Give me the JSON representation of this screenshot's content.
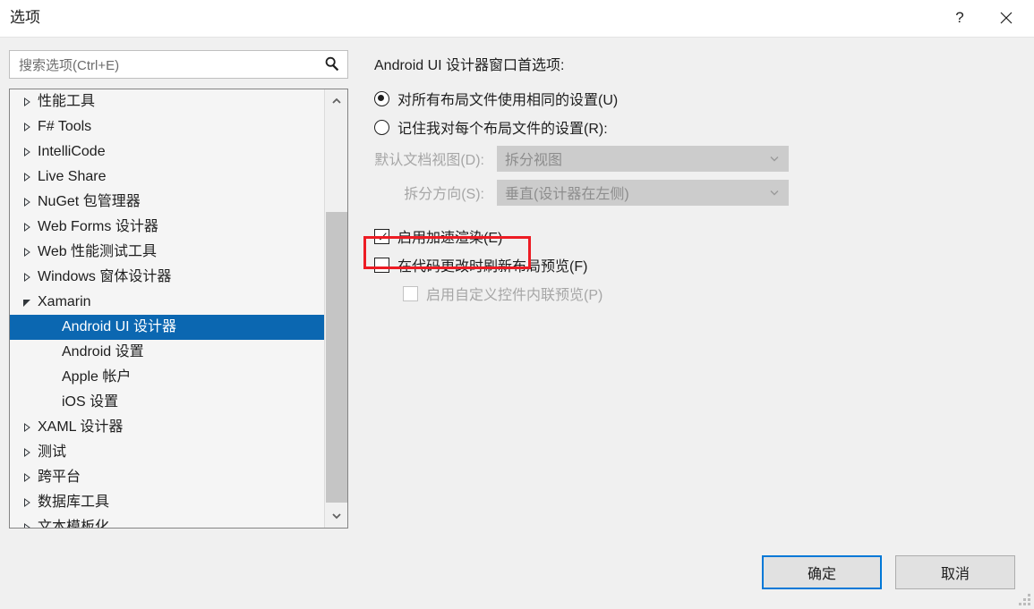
{
  "window": {
    "title": "选项",
    "help_icon": "question-mark-icon",
    "close_icon": "close-icon"
  },
  "search": {
    "placeholder": "搜索选项(Ctrl+E)",
    "value": "",
    "icon": "search-icon"
  },
  "tree": {
    "items": [
      {
        "label": "性能工具",
        "expander": "collapsed",
        "level": 1,
        "selected": false
      },
      {
        "label": "F# Tools",
        "expander": "collapsed",
        "level": 1,
        "selected": false
      },
      {
        "label": "IntelliCode",
        "expander": "collapsed",
        "level": 1,
        "selected": false
      },
      {
        "label": "Live Share",
        "expander": "collapsed",
        "level": 1,
        "selected": false
      },
      {
        "label": "NuGet 包管理器",
        "expander": "collapsed",
        "level": 1,
        "selected": false
      },
      {
        "label": "Web Forms 设计器",
        "expander": "collapsed",
        "level": 1,
        "selected": false
      },
      {
        "label": "Web 性能测试工具",
        "expander": "collapsed",
        "level": 1,
        "selected": false
      },
      {
        "label": "Windows 窗体设计器",
        "expander": "collapsed",
        "level": 1,
        "selected": false
      },
      {
        "label": "Xamarin",
        "expander": "expanded",
        "level": 1,
        "selected": false
      },
      {
        "label": "Android UI 设计器",
        "expander": "none",
        "level": 2,
        "selected": true
      },
      {
        "label": "Android 设置",
        "expander": "none",
        "level": 2,
        "selected": false
      },
      {
        "label": "Apple 帐户",
        "expander": "none",
        "level": 2,
        "selected": false
      },
      {
        "label": "iOS 设置",
        "expander": "none",
        "level": 2,
        "selected": false
      },
      {
        "label": "XAML 设计器",
        "expander": "collapsed",
        "level": 1,
        "selected": false
      },
      {
        "label": "测试",
        "expander": "collapsed",
        "level": 1,
        "selected": false
      },
      {
        "label": "跨平台",
        "expander": "collapsed",
        "level": 1,
        "selected": false
      },
      {
        "label": "数据库工具",
        "expander": "collapsed",
        "level": 1,
        "selected": false
      },
      {
        "label": "文本模板化",
        "expander": "collapsed",
        "level": 1,
        "selected": false
      }
    ],
    "scrollbar": {
      "up_icon": "chevron-up-icon",
      "down_icon": "chevron-down-icon"
    }
  },
  "pane": {
    "heading": "Android UI 设计器窗口首选项:",
    "radios": [
      {
        "label": "对所有布局文件使用相同的设置(U)",
        "checked": true
      },
      {
        "label": "记住我对每个布局文件的设置(R):",
        "checked": false
      }
    ],
    "dropdowns": [
      {
        "label": "默认文档视图(D):",
        "value": "拆分视图",
        "disabled": true
      },
      {
        "label": "拆分方向(S):",
        "value": "垂直(设计器在左侧)",
        "disabled": true
      }
    ],
    "checkboxes": [
      {
        "label": "启用加速渲染(E)",
        "checked": true,
        "disabled": false,
        "highlighted": true
      },
      {
        "label": "在代码更改时刷新布局预览(F)",
        "checked": false,
        "disabled": false,
        "highlighted": false
      },
      {
        "label": "启用自定义控件内联预览(P)",
        "checked": false,
        "disabled": true,
        "highlighted": false
      }
    ]
  },
  "footer": {
    "ok_label": "确定",
    "cancel_label": "取消"
  },
  "colors": {
    "accent": "#0078d7",
    "selection": "#0b67b1",
    "highlight": "#ed1c24",
    "dialog_bg": "#f0f0f0",
    "titlebar_bg": "#ffffff"
  }
}
